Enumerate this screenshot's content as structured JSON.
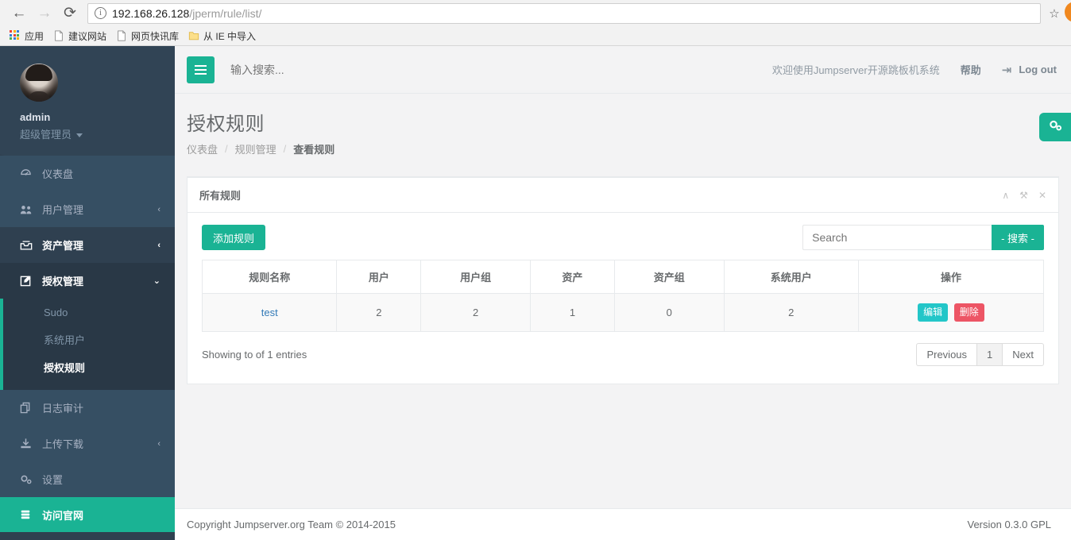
{
  "browser": {
    "back_icon": "back-arrow-icon",
    "forward_icon": "forward-arrow-icon",
    "reload_icon": "reload-icon",
    "url_host": "192.168.26.128",
    "url_path": "/jperm/rule/list/",
    "star_icon": "star-icon",
    "bookmarks": [
      {
        "icon": "apps-grid-icon",
        "label": "应用"
      },
      {
        "icon": "page-icon",
        "label": "建议网站"
      },
      {
        "icon": "page-icon",
        "label": "网页快讯库"
      },
      {
        "icon": "folder-icon",
        "label": "从 IE 中导入"
      }
    ]
  },
  "sidebar": {
    "user": {
      "avatar": "user-avatar",
      "name": "admin",
      "role": "超级管理员",
      "caret_icon": "caret-down-icon"
    },
    "items": [
      {
        "icon": "dashboard-icon",
        "label": "仪表盘",
        "arrow": ""
      },
      {
        "icon": "users-icon",
        "label": "用户管理",
        "arrow": "‹"
      },
      {
        "icon": "assets-icon",
        "label": "资产管理",
        "arrow": "‹"
      },
      {
        "icon": "edit-square-icon",
        "label": "授权管理",
        "arrow": "⌄"
      }
    ],
    "submenu": [
      {
        "label": "Sudo"
      },
      {
        "label": "系统用户"
      },
      {
        "label": "授权规则"
      }
    ],
    "items_tail": [
      {
        "icon": "copy-icon",
        "label": "日志审计",
        "arrow": ""
      },
      {
        "icon": "download-icon",
        "label": "上传下载",
        "arrow": "‹"
      },
      {
        "icon": "gears-icon",
        "label": "设置",
        "arrow": ""
      }
    ],
    "official": {
      "icon": "server-icon",
      "label": "访问官网"
    }
  },
  "topnav": {
    "menu_icon": "hamburger-icon",
    "search_placeholder": "输入搜索...",
    "welcome": "欢迎使用Jumpserver开源跳板机系统",
    "help": "帮助",
    "logout_icon": "logout-icon",
    "logout": "Log out"
  },
  "page": {
    "title": "授权规则",
    "breadcrumb": [
      {
        "label": "仪表盘",
        "current": false
      },
      {
        "label": "规则管理",
        "current": false
      },
      {
        "label": "查看规则",
        "current": true
      }
    ],
    "side_tab_icon": "gears-icon"
  },
  "panel": {
    "title": "所有规则",
    "tools": [
      {
        "icon": "chevron-up-icon",
        "glyph": "∧"
      },
      {
        "icon": "wrench-icon",
        "glyph": "⚒"
      },
      {
        "icon": "close-icon",
        "glyph": "✕"
      }
    ],
    "add_button": "添加规则",
    "search_placeholder": "Search",
    "search_button": "- 搜索 -",
    "table": {
      "columns": [
        "规则名称",
        "用户",
        "用户组",
        "资产",
        "资产组",
        "系统用户",
        "操作"
      ],
      "rows": [
        {
          "name": "test",
          "users": "2",
          "user_groups": "2",
          "assets": "1",
          "asset_groups": "0",
          "system_users": "2",
          "edit": "编辑",
          "delete": "删除"
        }
      ]
    },
    "showing": "Showing to of 1 entries",
    "pagination": {
      "previous": "Previous",
      "pages": [
        "1"
      ],
      "next": "Next"
    }
  },
  "footer": {
    "copyright": "Copyright Jumpserver.org Team © 2014-2015",
    "version": "Version 0.3.0 GPL"
  },
  "colors": {
    "brand_green": "#1ab394",
    "sidebar_bg": "#2f4050",
    "sidebar_active": "#293846",
    "edit_teal": "#23c6c8",
    "delete_red": "#ed5565",
    "link_blue": "#337ab7"
  }
}
